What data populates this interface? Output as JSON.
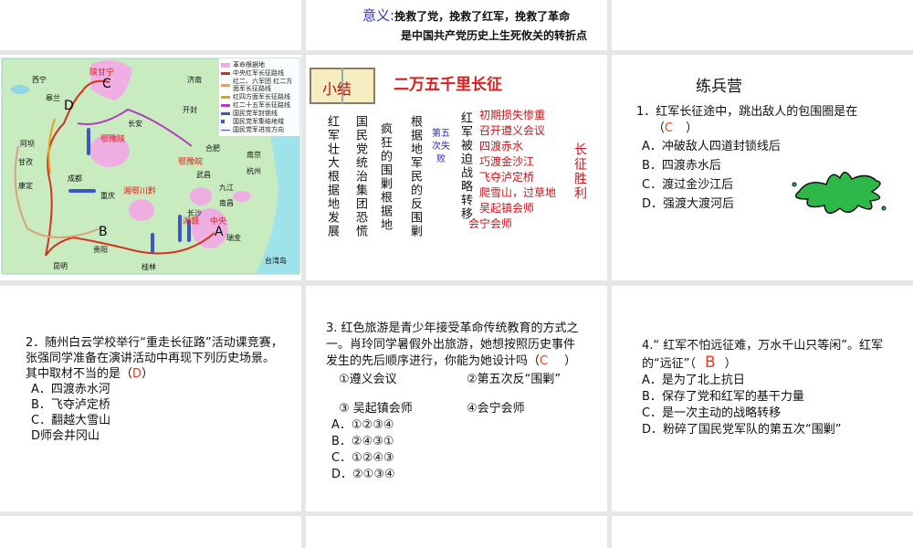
{
  "slides": {
    "s_top_middle": {
      "meaning_label": "意义:",
      "line1": "挽救了党，挽救了红军，挽救了革命",
      "line2": "是中国共产党历史上生死攸关的转折点"
    },
    "s_map": {
      "point_labels": [
        "A",
        "B",
        "C",
        "D"
      ],
      "cities": [
        "西宁",
        "皋兰",
        "济南",
        "开封",
        "长安",
        "阿坝",
        "甘孜",
        "成都",
        "康定",
        "重庆",
        "贵阳",
        "昆明",
        "桂林",
        "长沙",
        "武昌",
        "合肥",
        "南京",
        "杭州",
        "九江",
        "南昌",
        "瑞金",
        "台湾岛"
      ],
      "regions": [
        "陕甘宁",
        "鄂豫陕",
        "鄂豫皖",
        "湘鄂川黔",
        "湘赣",
        "中央"
      ],
      "legend": [
        "革命根据地",
        "中央红军长征路线",
        "红二、六军团 红二方面军长征路线",
        "红四方面军长征路线",
        "红二十五军长征路线",
        "国民党军封锁线",
        "国民党军集结地域",
        "国民党军进攻方向"
      ]
    },
    "s_summary": {
      "badge": "小结",
      "title": "二万五千里长征",
      "col1": "红军壮大根据地发展",
      "col2": "国民党统治集团恐慌",
      "col3": "疯狂的围剿根据地",
      "col4": "根据地军民的反围剿",
      "col5": "第五次失败",
      "col6": "红军被迫战略转移",
      "events": [
        "初期损失惨重",
        "召开遵义会议",
        "四渡赤水",
        "巧渡金沙江",
        "飞夺泸定桥",
        "爬雪山，过草地",
        "吴起镇会师",
        "会宁会师"
      ],
      "result": "长征胜利"
    },
    "s_q1": {
      "heading": "练兵营",
      "stem": "1．红军长征途中，跳出敌人的包围圈是在",
      "paren_open": "（",
      "answer": "C",
      "paren_close": "）",
      "options": [
        "A．冲破敌人四道封锁线后",
        "B．四渡赤水后",
        "C．渡过金沙江后",
        "D．强渡大渡河后"
      ],
      "splash_color": "#2fb84a"
    },
    "s_q2": {
      "stem": "2．随州白云学校举行“重走长征路”活动课竞赛，张强同学准备在演讲活动中再现下列历史场景。其中取材不当的是（",
      "answer": "D",
      "close": "）",
      "options": [
        "A．四渡赤水河",
        "B．飞夺泸定桥",
        "C．翻越大雪山",
        "D师会井冈山"
      ]
    },
    "s_q3": {
      "stem": "3. 红色旅游是青少年接受革命传统教育的方式之一。肖玲同学暑假外出旅游，她想按照历史事件发生的先后顺序进行，你能为她设计吗（",
      "answer": "C",
      "close": "）",
      "items": [
        "①遵义会议",
        "②第五次反“围剿”",
        "③ 吴起镇会师",
        "④会宁会师"
      ],
      "options": [
        "A．①②③④",
        "B．②④③①",
        "C．①②④③",
        "D．②①③④"
      ]
    },
    "s_q4": {
      "stem": "4.“ 红军不怕远征难，万水千山只等闲”。红军的“远征”（",
      "answer": "B",
      "close": "）",
      "options": [
        "A．是为了北上抗日",
        "B．保存了党和红军的基干力量",
        "C．是一次主动的战略转移",
        "D．粉碎了国民党军队的第五次“围剿”"
      ]
    }
  }
}
